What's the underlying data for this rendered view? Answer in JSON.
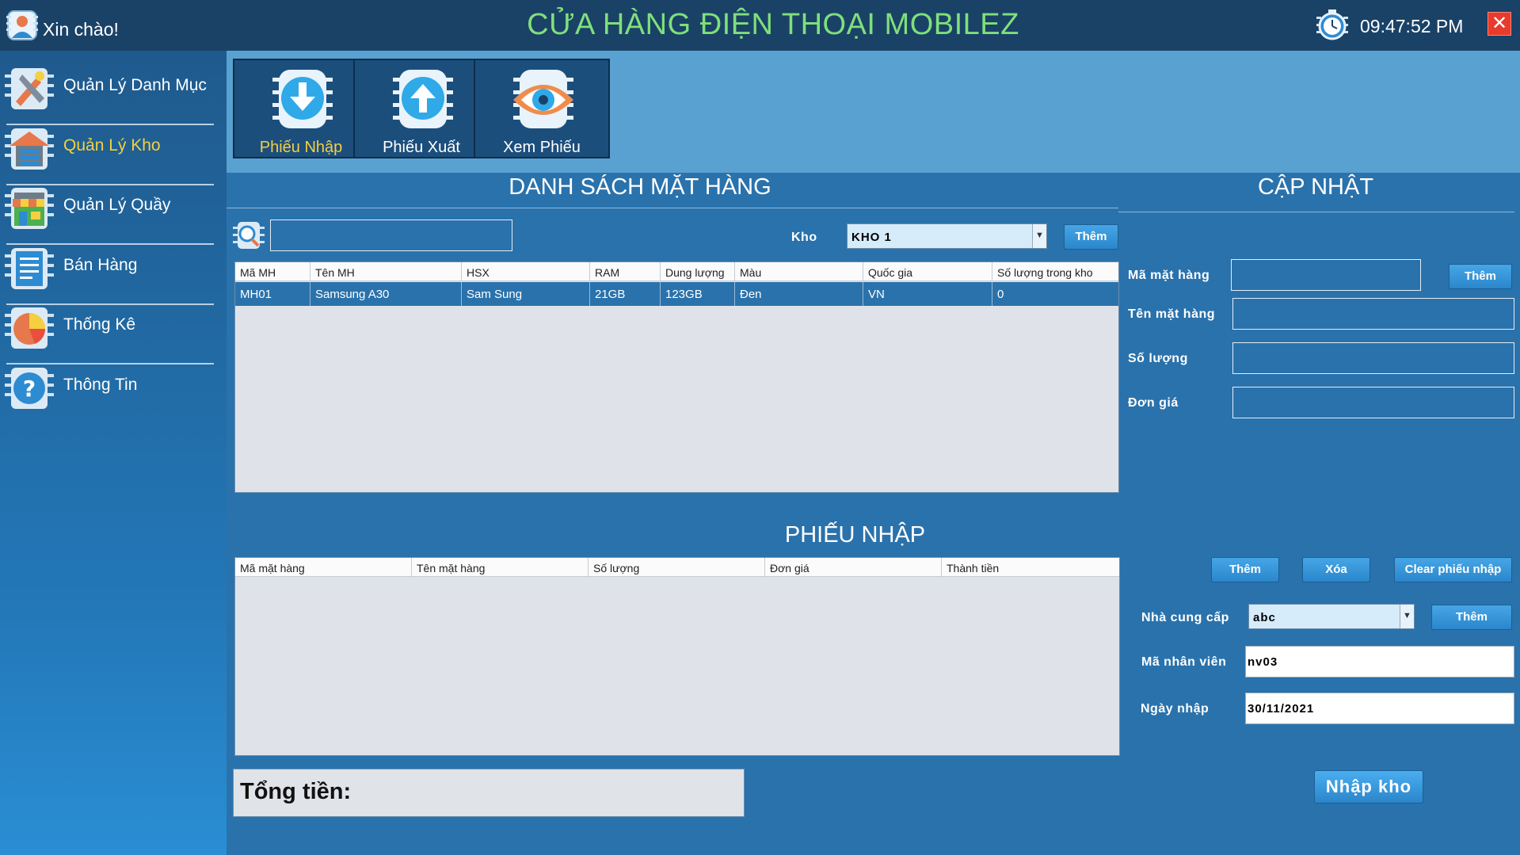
{
  "topbar": {
    "greeting": "Xin chào!",
    "title": "CỬA HÀNG ĐIỆN THOẠI MOBILEZ",
    "clock": "09:47:52 PM",
    "close": "✕"
  },
  "sidebar": {
    "items": [
      {
        "label": "Quản Lý Danh Mục",
        "icon": "tools-icon"
      },
      {
        "label": "Quản Lý Kho",
        "icon": "warehouse-icon",
        "active": true
      },
      {
        "label": "Quản Lý Quầy",
        "icon": "store-icon"
      },
      {
        "label": "Bán Hàng",
        "icon": "receipt-icon"
      },
      {
        "label": "Thống Kê",
        "icon": "pie-chart-icon"
      },
      {
        "label": "Thông Tin",
        "icon": "help-icon"
      }
    ]
  },
  "toolbar": {
    "buttons": [
      {
        "label": "Phiếu Nhập",
        "icon": "download-icon",
        "active": true
      },
      {
        "label": "Phiếu Xuất",
        "icon": "upload-icon"
      },
      {
        "label": "Xem Phiếu",
        "icon": "eye-icon"
      }
    ]
  },
  "items_section": {
    "title": "DANH SÁCH MẶT HÀNG",
    "search_value": "",
    "kho_label": "Kho",
    "kho_value": "KHO 1",
    "add_label": "Thêm",
    "columns": [
      "Mã MH",
      "Tên MH",
      "HSX",
      "RAM",
      "Dung lượng",
      "Màu",
      "Quốc gia",
      "Số lượng trong kho"
    ],
    "rows": [
      [
        "MH01",
        "Samsung A30",
        "Sam Sung",
        "21GB",
        "123GB",
        "Đen",
        "VN",
        "0"
      ]
    ]
  },
  "update_section": {
    "title": "CẬP NHẬT",
    "ma_label": "Mã mặt hàng",
    "ma_value": "",
    "ten_label": "Tên mặt hàng",
    "ten_value": "",
    "soluong_label": "Số lượng",
    "soluong_value": "",
    "dongia_label": "Đơn giá",
    "dongia_value": "",
    "add_label": "Thêm"
  },
  "receipt_section": {
    "title": "PHIẾU NHẬP",
    "columns": [
      "Mã mặt hàng",
      "Tên mặt hàng",
      "Số lượng",
      "Đơn giá",
      "Thành tiền"
    ],
    "add_label": "Thêm",
    "delete_label": "Xóa",
    "clear_label": "Clear phiếu nhập",
    "supplier_label": "Nhà cung cấp",
    "supplier_value": "abc",
    "supplier_add_label": "Thêm",
    "employee_label": "Mã nhân viên",
    "employee_value": "nv03",
    "date_label": "Ngày nhập",
    "date_value": "30/11/2021",
    "total_label": "Tổng tiền:",
    "import_label": "Nhập kho"
  },
  "colors": {
    "background": "#2a72ac",
    "topbar": "#1a4267",
    "title_green": "#7fe07a",
    "active_yellow": "#f4d03f",
    "close_red": "#e83b2c"
  }
}
